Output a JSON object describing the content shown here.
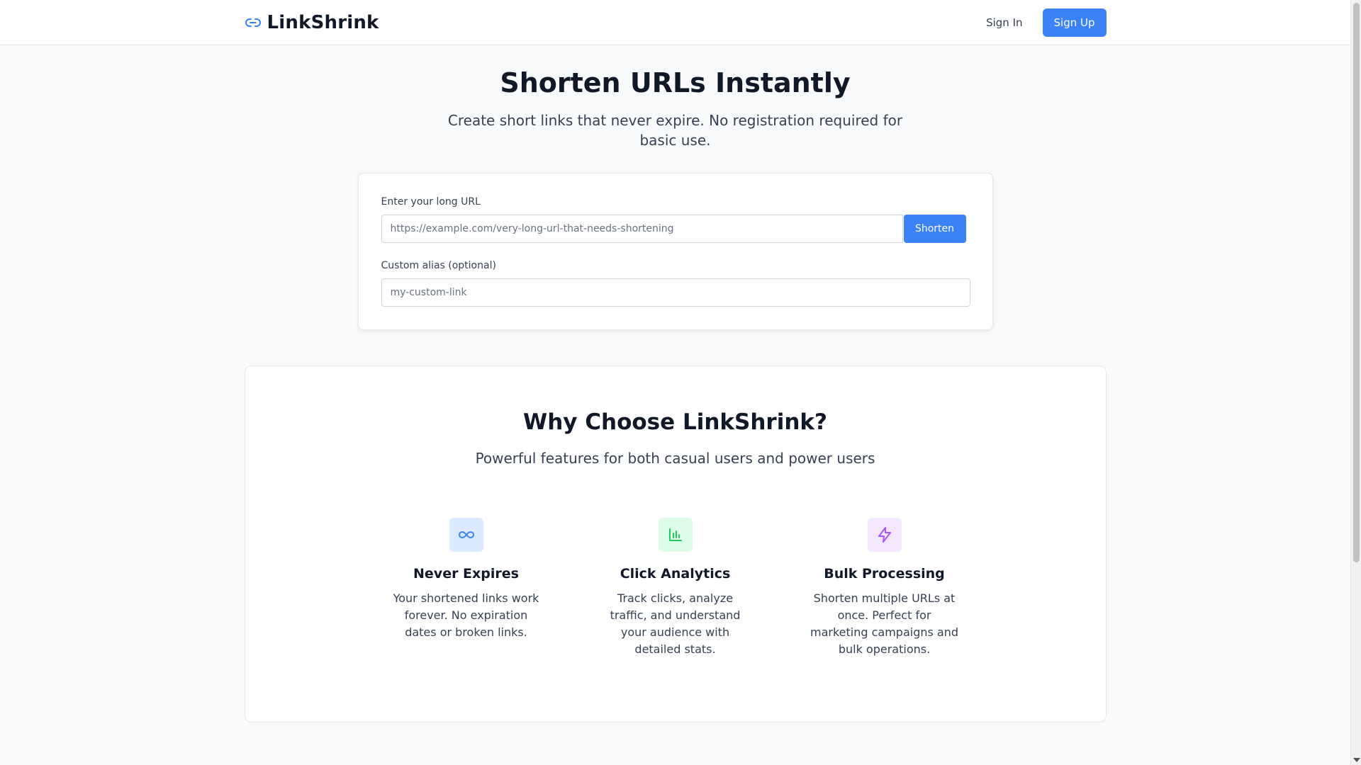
{
  "header": {
    "brand_name": "LinkShrink",
    "brand_icon": "link-icon",
    "sign_in_label": "Sign In",
    "sign_up_label": "Sign Up"
  },
  "hero": {
    "title": "Shorten URLs Instantly",
    "subtitle": "Create short links that never expire. No registration required for basic use."
  },
  "form": {
    "url_label": "Enter your long URL",
    "url_placeholder": "https://example.com/very-long-url-that-needs-shortening",
    "url_value": "",
    "shorten_label": "Shorten",
    "alias_label": "Custom alias (optional)",
    "alias_placeholder": "my-custom-link",
    "alias_value": ""
  },
  "features": {
    "title": "Why Choose LinkShrink?",
    "subtitle": "Powerful features for both casual users and power users",
    "items": [
      {
        "icon": "infinity-icon",
        "title": "Never Expires",
        "description": "Your shortened links work forever. No expiration dates or broken links."
      },
      {
        "icon": "bar-chart-icon",
        "title": "Click Analytics",
        "description": "Track clicks, analyze traffic, and understand your audience with detailed stats."
      },
      {
        "icon": "lightning-icon",
        "title": "Bulk Processing",
        "description": "Shorten multiple URLs at once. Perfect for marketing campaigns and bulk operations."
      }
    ]
  },
  "colors": {
    "primary": "#3b82f6",
    "background": "#f9fafb",
    "text": "#111827",
    "icon_blue_bg": "#dbeafe",
    "icon_green_bg": "#dcfce7",
    "icon_purple_bg": "#f3e8ff"
  }
}
